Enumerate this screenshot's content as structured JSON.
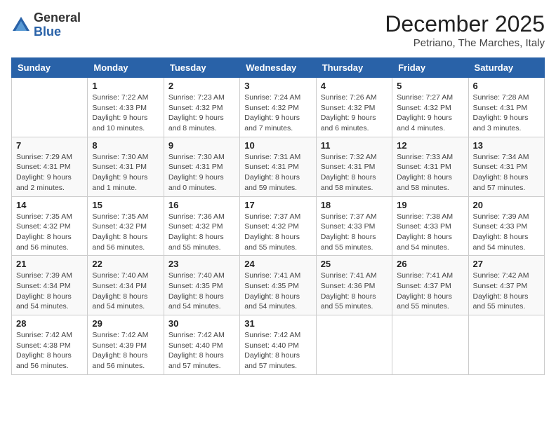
{
  "logo": {
    "general": "General",
    "blue": "Blue"
  },
  "header": {
    "month": "December 2025",
    "location": "Petriano, The Marches, Italy"
  },
  "days_of_week": [
    "Sunday",
    "Monday",
    "Tuesday",
    "Wednesday",
    "Thursday",
    "Friday",
    "Saturday"
  ],
  "weeks": [
    [
      {
        "day": "",
        "info": ""
      },
      {
        "day": "1",
        "info": "Sunrise: 7:22 AM\nSunset: 4:33 PM\nDaylight: 9 hours\nand 10 minutes."
      },
      {
        "day": "2",
        "info": "Sunrise: 7:23 AM\nSunset: 4:32 PM\nDaylight: 9 hours\nand 8 minutes."
      },
      {
        "day": "3",
        "info": "Sunrise: 7:24 AM\nSunset: 4:32 PM\nDaylight: 9 hours\nand 7 minutes."
      },
      {
        "day": "4",
        "info": "Sunrise: 7:26 AM\nSunset: 4:32 PM\nDaylight: 9 hours\nand 6 minutes."
      },
      {
        "day": "5",
        "info": "Sunrise: 7:27 AM\nSunset: 4:32 PM\nDaylight: 9 hours\nand 4 minutes."
      },
      {
        "day": "6",
        "info": "Sunrise: 7:28 AM\nSunset: 4:31 PM\nDaylight: 9 hours\nand 3 minutes."
      }
    ],
    [
      {
        "day": "7",
        "info": "Sunrise: 7:29 AM\nSunset: 4:31 PM\nDaylight: 9 hours\nand 2 minutes."
      },
      {
        "day": "8",
        "info": "Sunrise: 7:30 AM\nSunset: 4:31 PM\nDaylight: 9 hours\nand 1 minute."
      },
      {
        "day": "9",
        "info": "Sunrise: 7:30 AM\nSunset: 4:31 PM\nDaylight: 9 hours\nand 0 minutes."
      },
      {
        "day": "10",
        "info": "Sunrise: 7:31 AM\nSunset: 4:31 PM\nDaylight: 8 hours\nand 59 minutes."
      },
      {
        "day": "11",
        "info": "Sunrise: 7:32 AM\nSunset: 4:31 PM\nDaylight: 8 hours\nand 58 minutes."
      },
      {
        "day": "12",
        "info": "Sunrise: 7:33 AM\nSunset: 4:31 PM\nDaylight: 8 hours\nand 58 minutes."
      },
      {
        "day": "13",
        "info": "Sunrise: 7:34 AM\nSunset: 4:31 PM\nDaylight: 8 hours\nand 57 minutes."
      }
    ],
    [
      {
        "day": "14",
        "info": "Sunrise: 7:35 AM\nSunset: 4:32 PM\nDaylight: 8 hours\nand 56 minutes."
      },
      {
        "day": "15",
        "info": "Sunrise: 7:35 AM\nSunset: 4:32 PM\nDaylight: 8 hours\nand 56 minutes."
      },
      {
        "day": "16",
        "info": "Sunrise: 7:36 AM\nSunset: 4:32 PM\nDaylight: 8 hours\nand 55 minutes."
      },
      {
        "day": "17",
        "info": "Sunrise: 7:37 AM\nSunset: 4:32 PM\nDaylight: 8 hours\nand 55 minutes."
      },
      {
        "day": "18",
        "info": "Sunrise: 7:37 AM\nSunset: 4:33 PM\nDaylight: 8 hours\nand 55 minutes."
      },
      {
        "day": "19",
        "info": "Sunrise: 7:38 AM\nSunset: 4:33 PM\nDaylight: 8 hours\nand 54 minutes."
      },
      {
        "day": "20",
        "info": "Sunrise: 7:39 AM\nSunset: 4:33 PM\nDaylight: 8 hours\nand 54 minutes."
      }
    ],
    [
      {
        "day": "21",
        "info": "Sunrise: 7:39 AM\nSunset: 4:34 PM\nDaylight: 8 hours\nand 54 minutes."
      },
      {
        "day": "22",
        "info": "Sunrise: 7:40 AM\nSunset: 4:34 PM\nDaylight: 8 hours\nand 54 minutes."
      },
      {
        "day": "23",
        "info": "Sunrise: 7:40 AM\nSunset: 4:35 PM\nDaylight: 8 hours\nand 54 minutes."
      },
      {
        "day": "24",
        "info": "Sunrise: 7:41 AM\nSunset: 4:35 PM\nDaylight: 8 hours\nand 54 minutes."
      },
      {
        "day": "25",
        "info": "Sunrise: 7:41 AM\nSunset: 4:36 PM\nDaylight: 8 hours\nand 55 minutes."
      },
      {
        "day": "26",
        "info": "Sunrise: 7:41 AM\nSunset: 4:37 PM\nDaylight: 8 hours\nand 55 minutes."
      },
      {
        "day": "27",
        "info": "Sunrise: 7:42 AM\nSunset: 4:37 PM\nDaylight: 8 hours\nand 55 minutes."
      }
    ],
    [
      {
        "day": "28",
        "info": "Sunrise: 7:42 AM\nSunset: 4:38 PM\nDaylight: 8 hours\nand 56 minutes."
      },
      {
        "day": "29",
        "info": "Sunrise: 7:42 AM\nSunset: 4:39 PM\nDaylight: 8 hours\nand 56 minutes."
      },
      {
        "day": "30",
        "info": "Sunrise: 7:42 AM\nSunset: 4:40 PM\nDaylight: 8 hours\nand 57 minutes."
      },
      {
        "day": "31",
        "info": "Sunrise: 7:42 AM\nSunset: 4:40 PM\nDaylight: 8 hours\nand 57 minutes."
      },
      {
        "day": "",
        "info": ""
      },
      {
        "day": "",
        "info": ""
      },
      {
        "day": "",
        "info": ""
      }
    ]
  ]
}
